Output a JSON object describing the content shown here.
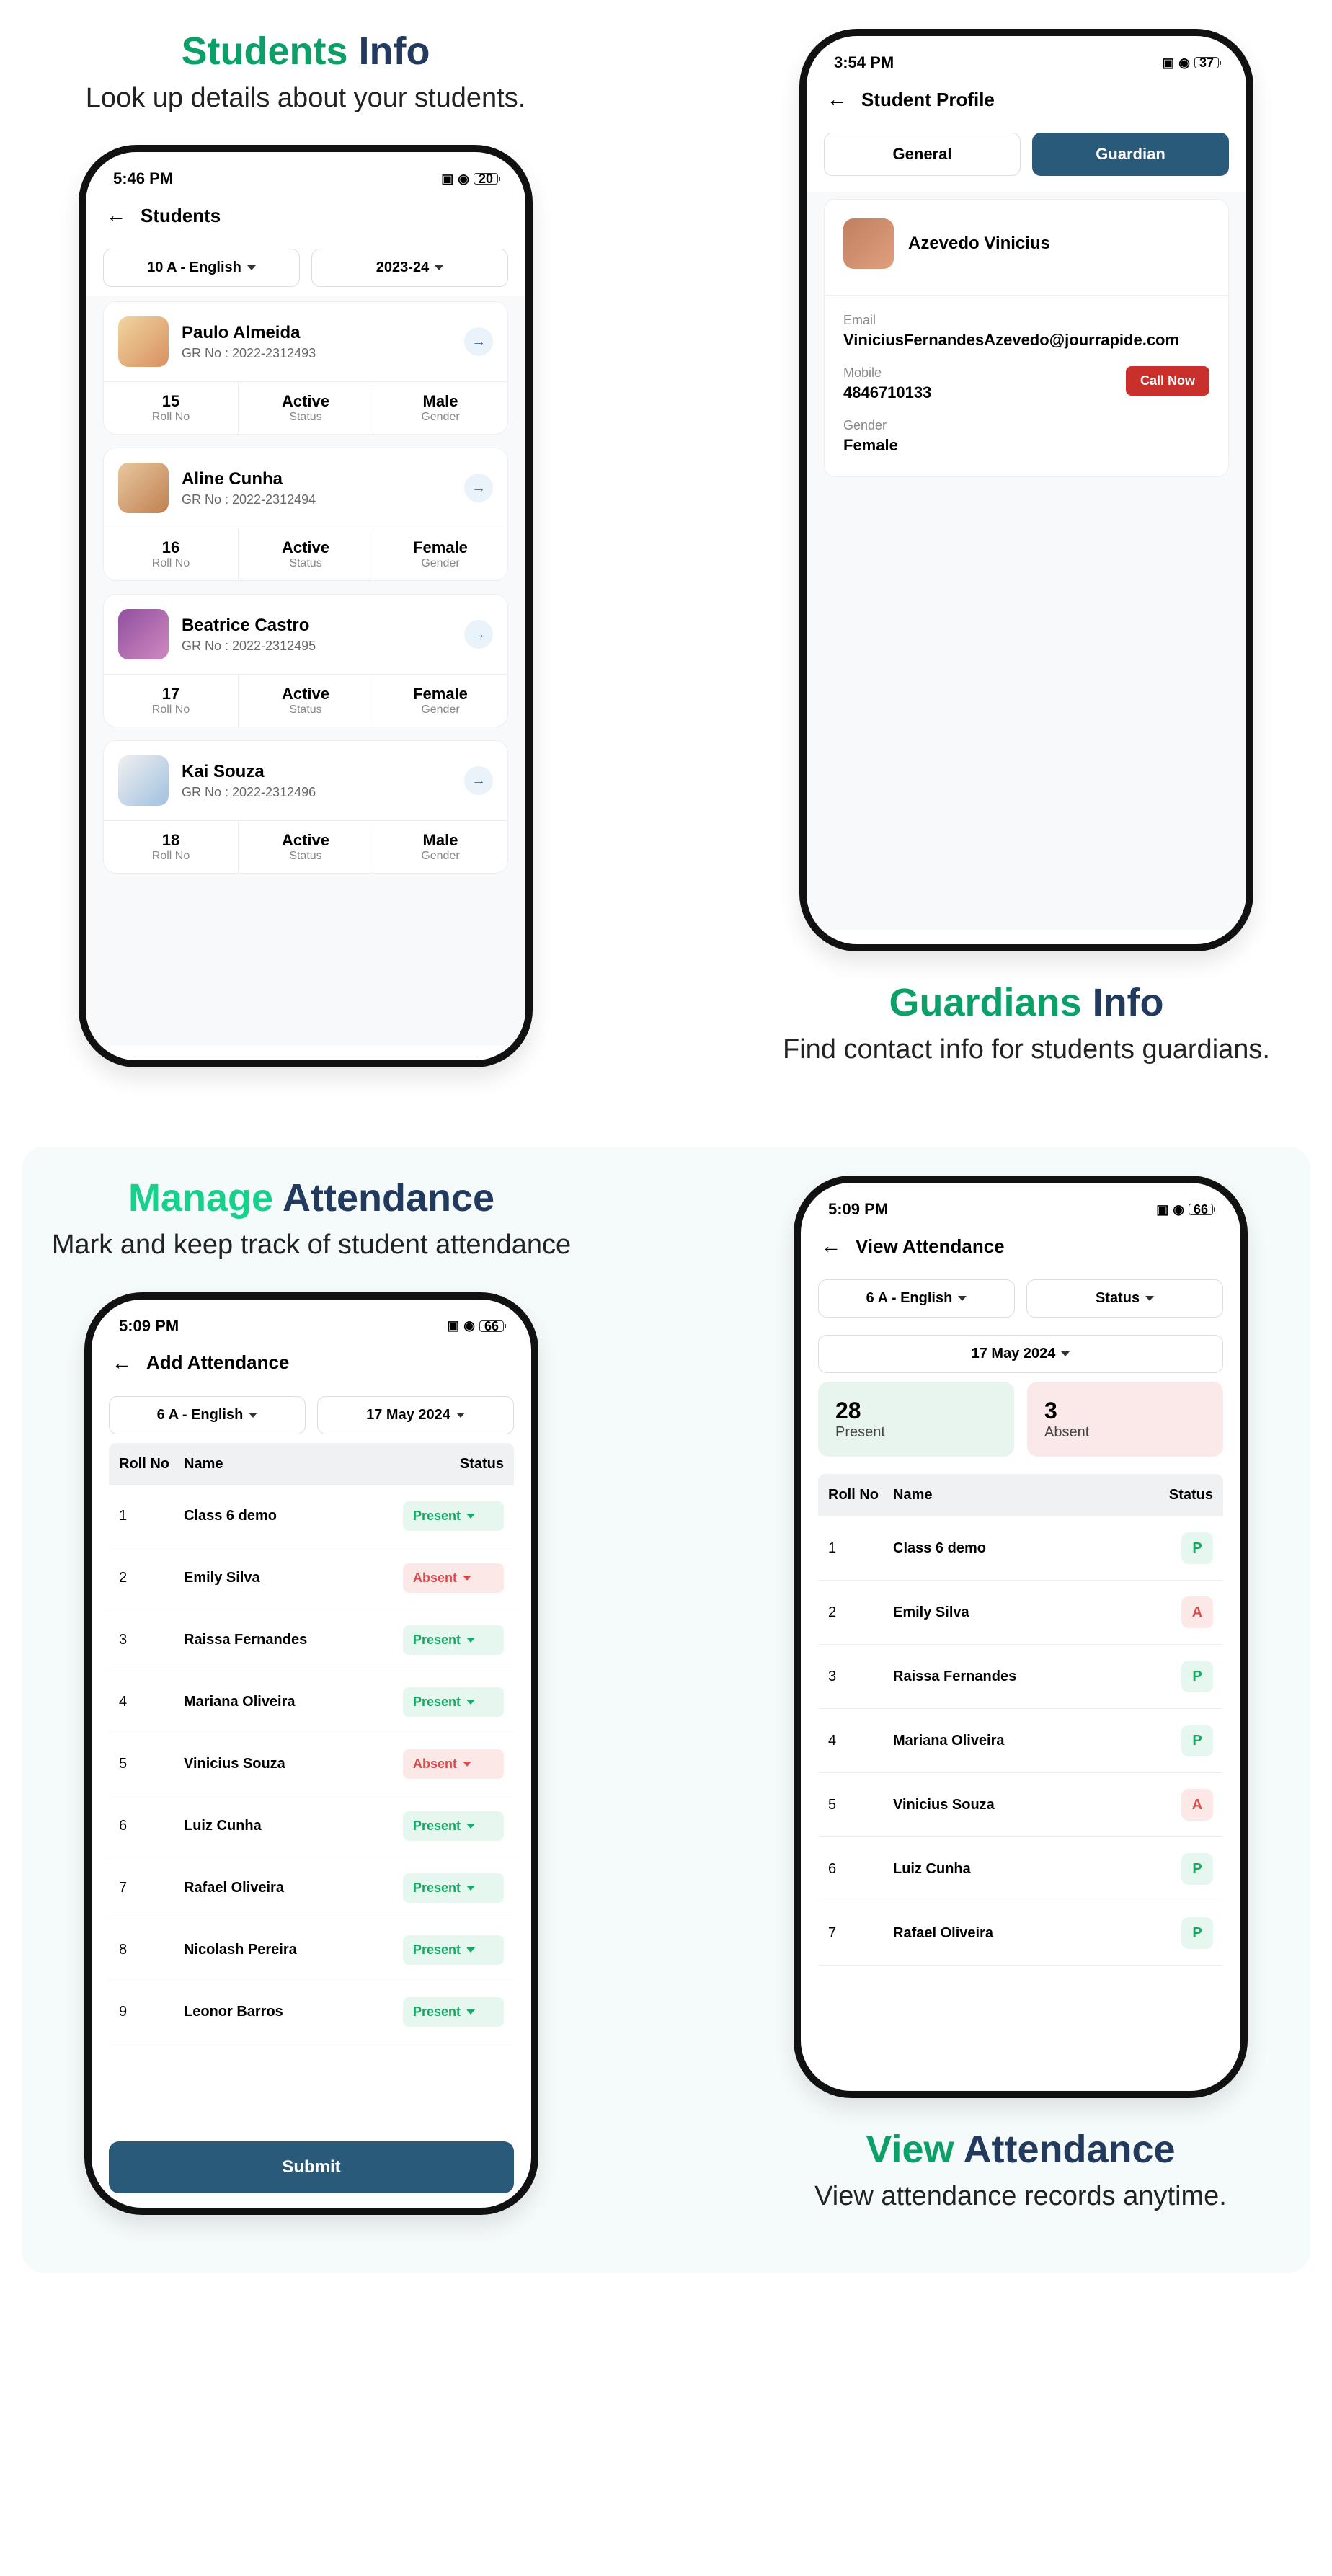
{
  "section1": {
    "title_accent": "Students",
    "title_rest": "Info",
    "subtitle": "Look up details about your students."
  },
  "section2": {
    "title_accent": "Guardians",
    "title_rest": "Info",
    "subtitle": "Find contact info for students guardians."
  },
  "section3": {
    "title_accent": "Manage",
    "title_rest": "Attendance",
    "subtitle": "Mark and keep track of  student attendance"
  },
  "section4": {
    "title_accent": "View",
    "title_rest": "Attendance",
    "subtitle": "View attendance records anytime."
  },
  "screen_students": {
    "time": "5:46 PM",
    "battery": "20",
    "title": "Students",
    "filter_class": "10 A - English",
    "filter_year": "2023-24",
    "students": [
      {
        "name": "Paulo Almeida",
        "gr": "GR No : 2022-2312493",
        "roll": "15",
        "status": "Active",
        "gender": "Male"
      },
      {
        "name": "Aline Cunha",
        "gr": "GR No : 2022-2312494",
        "roll": "16",
        "status": "Active",
        "gender": "Female"
      },
      {
        "name": "Beatrice Castro",
        "gr": "GR No : 2022-2312495",
        "roll": "17",
        "status": "Active",
        "gender": "Female"
      },
      {
        "name": "Kai Souza",
        "gr": "GR No : 2022-2312496",
        "roll": "18",
        "status": "Active",
        "gender": "Male"
      }
    ],
    "labels": {
      "roll": "Roll No",
      "status": "Status",
      "gender": "Gender"
    }
  },
  "screen_profile": {
    "time": "3:54 PM",
    "battery": "37",
    "title": "Student Profile",
    "tab_general": "General",
    "tab_guardian": "Guardian",
    "guardian_name": "Azevedo Vinicius",
    "email_label": "Email",
    "email": "ViniciusFernandesAzevedo@jourrapide.com",
    "mobile_label": "Mobile",
    "mobile": "4846710133",
    "gender_label": "Gender",
    "gender": "Female",
    "call_btn": "Call Now"
  },
  "screen_add_att": {
    "time": "5:09 PM",
    "battery": "66",
    "title": "Add Attendance",
    "filter_class": "6 A - English",
    "filter_date": "17 May 2024",
    "head_roll": "Roll No",
    "head_name": "Name",
    "head_status": "Status",
    "submit": "Submit",
    "rows": [
      {
        "roll": "1",
        "name": "Class 6 demo",
        "status": "Present",
        "cls": "present"
      },
      {
        "roll": "2",
        "name": "Emily Silva",
        "status": "Absent",
        "cls": "absent"
      },
      {
        "roll": "3",
        "name": "Raissa Fernandes",
        "status": "Present",
        "cls": "present"
      },
      {
        "roll": "4",
        "name": "Mariana Oliveira",
        "status": "Present",
        "cls": "present"
      },
      {
        "roll": "5",
        "name": "Vinicius Souza",
        "status": "Absent",
        "cls": "absent"
      },
      {
        "roll": "6",
        "name": "Luiz Cunha",
        "status": "Present",
        "cls": "present"
      },
      {
        "roll": "7",
        "name": "Rafael Oliveira",
        "status": "Present",
        "cls": "present"
      },
      {
        "roll": "8",
        "name": "Nicolash Pereira",
        "status": "Present",
        "cls": "present"
      },
      {
        "roll": "9",
        "name": "Leonor Barros",
        "status": "Present",
        "cls": "present"
      }
    ]
  },
  "screen_view_att": {
    "time": "5:09 PM",
    "battery": "66",
    "title": "View Attendance",
    "filter_class": "6 A - English",
    "filter_status": "Status",
    "filter_date": "17 May 2024",
    "present_num": "28",
    "present_label": "Present",
    "absent_num": "3",
    "absent_label": "Absent",
    "head_roll": "Roll No",
    "head_name": "Name",
    "head_status": "Status",
    "rows": [
      {
        "roll": "1",
        "name": "Class 6 demo",
        "badge": "P",
        "cls": "p"
      },
      {
        "roll": "2",
        "name": "Emily Silva",
        "badge": "A",
        "cls": "a"
      },
      {
        "roll": "3",
        "name": "Raissa Fernandes",
        "badge": "P",
        "cls": "p"
      },
      {
        "roll": "4",
        "name": "Mariana Oliveira",
        "badge": "P",
        "cls": "p"
      },
      {
        "roll": "5",
        "name": "Vinicius Souza",
        "badge": "A",
        "cls": "a"
      },
      {
        "roll": "6",
        "name": "Luiz Cunha",
        "badge": "P",
        "cls": "p"
      },
      {
        "roll": "7",
        "name": "Rafael Oliveira",
        "badge": "P",
        "cls": "p"
      }
    ]
  }
}
